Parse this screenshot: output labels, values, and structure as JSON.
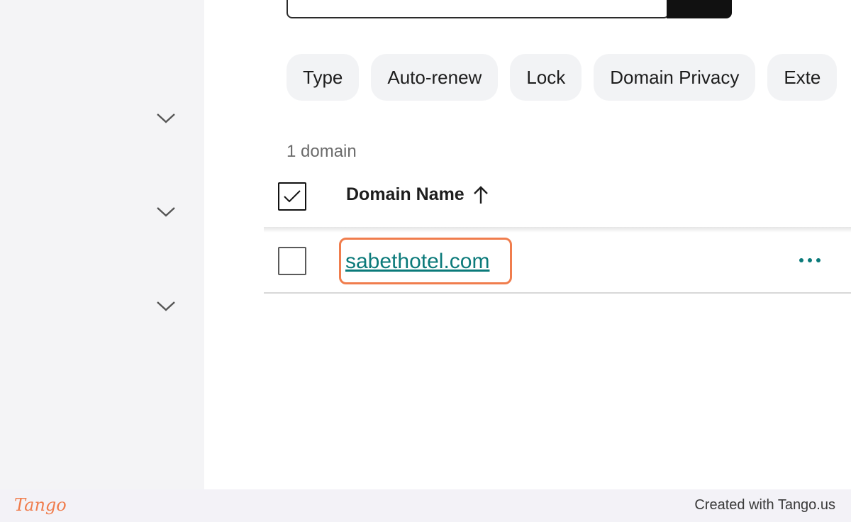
{
  "sidebar": {
    "chevrons": [
      "chevron-down-icon",
      "chevron-down-icon",
      "chevron-down-icon"
    ]
  },
  "filters": {
    "chips": [
      "Type",
      "Auto-renew",
      "Lock",
      "Domain Privacy",
      "Exte"
    ]
  },
  "table": {
    "count_label": "1 domain",
    "column_header": "Domain Name",
    "sort_icon": "arrow-up-icon",
    "rows": [
      {
        "domain": "sabethotel.com",
        "actions_icon": "more-horizontal-icon"
      }
    ]
  },
  "footer": {
    "logo": "Tango",
    "credit": "Created with Tango.us"
  },
  "colors": {
    "link": "#0b7a7a",
    "highlight": "#f07d4d",
    "sidebar_bg": "#f4f4f6"
  }
}
